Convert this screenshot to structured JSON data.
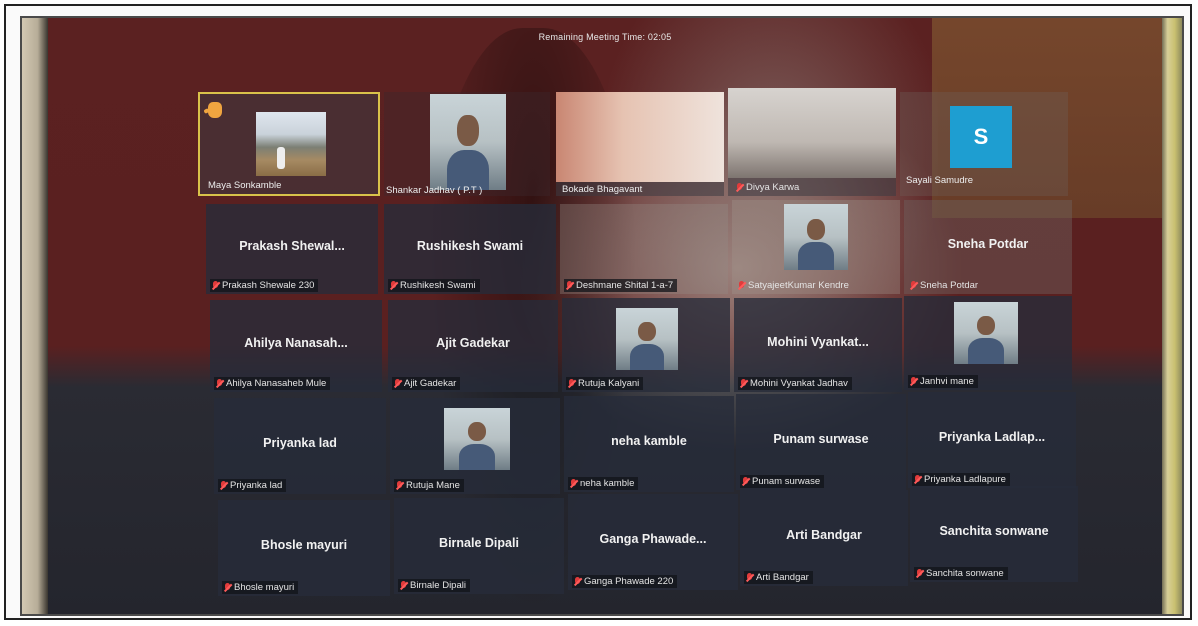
{
  "meeting": {
    "remaining_time": "Remaining Meeting Time: 02:05"
  },
  "colors": {
    "tile_bg": "#262c3a",
    "active_speaker_border": "#d9c24a",
    "muted_mic": "#e03b3b",
    "avatar_s": "#1e9ed1"
  },
  "video_tiles": [
    {
      "name": "Maya Sonkamble"
    },
    {
      "name": "Shankar Jadhav ( P.T )"
    },
    {
      "name": "Bokade Bhagavant"
    },
    {
      "name": "Divya Karwa"
    },
    {
      "name": "Sayali Samudre",
      "avatar_letter": "S"
    }
  ],
  "tiles": [
    {
      "center": "Prakash Shewal...",
      "label": "Prakash Shewale 230"
    },
    {
      "center": "Rushikesh Swami",
      "label": "Rushikesh Swami"
    },
    {
      "center": "",
      "label": "Deshmane Shital 1-a-7"
    },
    {
      "center": "",
      "label": "SatyajeetKumar Kendre"
    },
    {
      "center": "Sneha Potdar",
      "label": "Sneha Potdar"
    },
    {
      "center": "Ahilya Nanasah...",
      "label": "Ahilya Nanasaheb Mule"
    },
    {
      "center": "Ajit Gadekar",
      "label": "Ajit Gadekar"
    },
    {
      "center": "",
      "label": "Rutuja Kalyani"
    },
    {
      "center": "Mohini Vyankat...",
      "label": "Mohini Vyankat Jadhav"
    },
    {
      "center": "",
      "label": "Janhvi mane"
    },
    {
      "center": "Priyanka lad",
      "label": "Priyanka lad"
    },
    {
      "center": "",
      "label": "Rutuja Mane"
    },
    {
      "center": "neha kamble",
      "label": "neha kamble"
    },
    {
      "center": "Punam surwase",
      "label": "Punam surwase"
    },
    {
      "center": "Priyanka Ladlap...",
      "label": "Priyanka Ladlapure"
    },
    {
      "center": "Bhosle mayuri",
      "label": "Bhosle mayuri"
    },
    {
      "center": "Birnale Dipali",
      "label": "Birnale Dipali"
    },
    {
      "center": "Ganga Phawade...",
      "label": "Ganga Phawade 220"
    },
    {
      "center": "Arti Bandgar",
      "label": "Arti Bandgar"
    },
    {
      "center": "Sanchita sonwane",
      "label": "Sanchita sonwane"
    }
  ]
}
